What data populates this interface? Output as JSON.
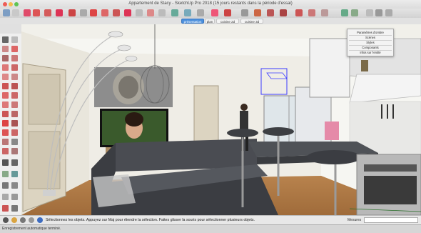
{
  "window": {
    "title": "Appartement de Stacy - SketchUp Pro 2018 (15 jours restants dans la période d'essai)"
  },
  "scene_tabs": [
    {
      "label": "présentation",
      "active": true
    },
    {
      "label": "plan",
      "active": false
    },
    {
      "label": "cuisine 2d",
      "active": false
    },
    {
      "label": "cuisine 3d",
      "active": false
    }
  ],
  "tray": {
    "items": [
      "Paramètres d'ombre",
      "Scènes",
      "Styles",
      "Composants",
      "Infos sur l'entité"
    ]
  },
  "status": {
    "message": "Sélectionnez les objets. Appuyez sur Maj pour étendre la sélection. Faites glisser la souris pour sélectionner plusieurs objets.",
    "measurements_label": "Mesures"
  },
  "footer": {
    "text": "Enregistrement automatique terminé."
  },
  "colors": {
    "accent": "#4b8fdc",
    "floor": "#b07a45",
    "sofa": "#3b3d42"
  }
}
